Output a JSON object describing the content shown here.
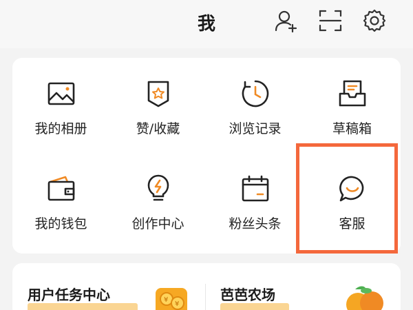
{
  "header": {
    "title": "我",
    "icons": [
      "add-user-icon",
      "scan-icon",
      "gear-icon"
    ]
  },
  "grid": {
    "items": [
      {
        "label": "我的相册",
        "icon": "album-icon"
      },
      {
        "label": "赞/收藏",
        "icon": "favorite-badge-icon"
      },
      {
        "label": "浏览记录",
        "icon": "history-clock-icon"
      },
      {
        "label": "草稿箱",
        "icon": "draft-box-icon"
      },
      {
        "label": "我的钱包",
        "icon": "wallet-icon"
      },
      {
        "label": "创作中心",
        "icon": "lightbulb-icon"
      },
      {
        "label": "粉丝头条",
        "icon": "calendar-icon"
      },
      {
        "label": "客服",
        "icon": "chat-bubble-icon"
      }
    ]
  },
  "promos": [
    {
      "title": "用户任务中心",
      "icon": "gold-coins-icon"
    },
    {
      "title": "芭芭农场",
      "icon": "fruit-icon"
    }
  ],
  "colors": {
    "highlight": "#f4683c",
    "icon": "#222222",
    "accent_orange": "#f08a24"
  }
}
